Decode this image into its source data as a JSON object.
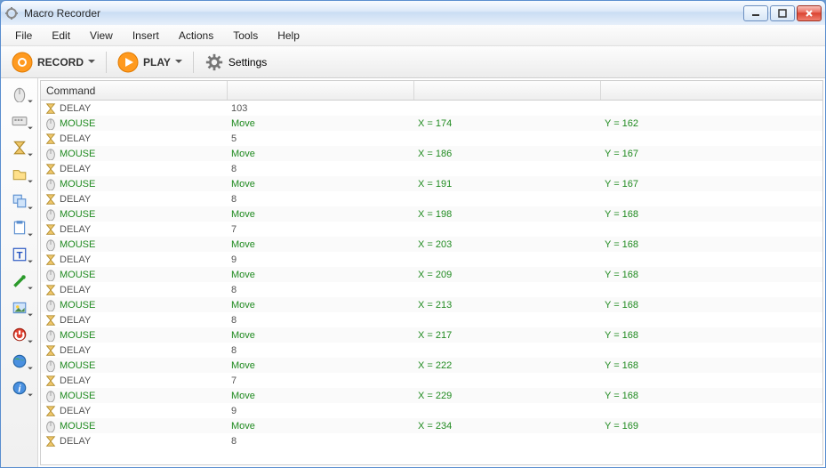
{
  "window": {
    "title": "Macro Recorder"
  },
  "menu": {
    "items": [
      "File",
      "Edit",
      "View",
      "Insert",
      "Actions",
      "Tools",
      "Help"
    ]
  },
  "toolbar": {
    "record_label": "RECORD",
    "play_label": "PLAY",
    "settings_label": "Settings"
  },
  "sidebar": {
    "items": [
      {
        "name": "mouse-tool",
        "icon": "mouse"
      },
      {
        "name": "keyboard-tool",
        "icon": "keyboard"
      },
      {
        "name": "delay-tool",
        "icon": "hourglass"
      },
      {
        "name": "open-file-tool",
        "icon": "folder"
      },
      {
        "name": "window-tool",
        "icon": "windows"
      },
      {
        "name": "clipboard-tool",
        "icon": "clipboard"
      },
      {
        "name": "text-tool",
        "icon": "text"
      },
      {
        "name": "color-picker-tool",
        "icon": "eyedropper"
      },
      {
        "name": "image-tool",
        "icon": "image"
      },
      {
        "name": "shutdown-tool",
        "icon": "power"
      },
      {
        "name": "network-tool",
        "icon": "globe"
      },
      {
        "name": "info-tool",
        "icon": "info"
      }
    ]
  },
  "grid": {
    "header": "Command",
    "rows": [
      {
        "t": "delay",
        "v": "103"
      },
      {
        "t": "mouse",
        "a": "Move",
        "x": "174",
        "y": "162"
      },
      {
        "t": "delay",
        "v": "5"
      },
      {
        "t": "mouse",
        "a": "Move",
        "x": "186",
        "y": "167"
      },
      {
        "t": "delay",
        "v": "8"
      },
      {
        "t": "mouse",
        "a": "Move",
        "x": "191",
        "y": "167"
      },
      {
        "t": "delay",
        "v": "8"
      },
      {
        "t": "mouse",
        "a": "Move",
        "x": "198",
        "y": "168"
      },
      {
        "t": "delay",
        "v": "7"
      },
      {
        "t": "mouse",
        "a": "Move",
        "x": "203",
        "y": "168"
      },
      {
        "t": "delay",
        "v": "9"
      },
      {
        "t": "mouse",
        "a": "Move",
        "x": "209",
        "y": "168"
      },
      {
        "t": "delay",
        "v": "8"
      },
      {
        "t": "mouse",
        "a": "Move",
        "x": "213",
        "y": "168"
      },
      {
        "t": "delay",
        "v": "8"
      },
      {
        "t": "mouse",
        "a": "Move",
        "x": "217",
        "y": "168"
      },
      {
        "t": "delay",
        "v": "8"
      },
      {
        "t": "mouse",
        "a": "Move",
        "x": "222",
        "y": "168"
      },
      {
        "t": "delay",
        "v": "7"
      },
      {
        "t": "mouse",
        "a": "Move",
        "x": "229",
        "y": "168"
      },
      {
        "t": "delay",
        "v": "9"
      },
      {
        "t": "mouse",
        "a": "Move",
        "x": "234",
        "y": "169"
      },
      {
        "t": "delay",
        "v": "8"
      }
    ],
    "labels": {
      "delay": "DELAY",
      "mouse": "MOUSE",
      "x_prefix": "X = ",
      "y_prefix": "Y = "
    }
  }
}
